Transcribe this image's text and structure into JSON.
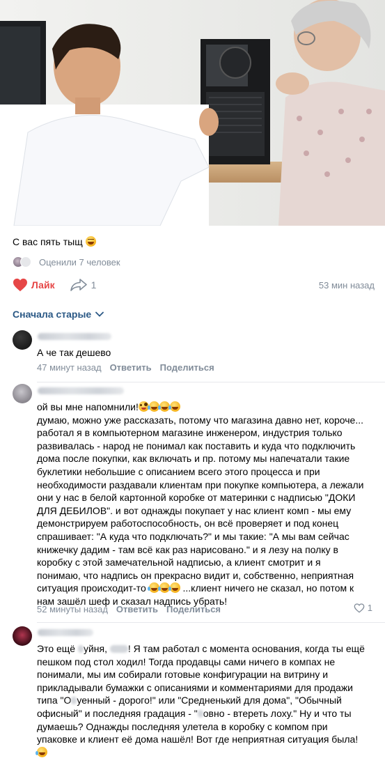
{
  "post": {
    "caption": "С вас пять тыщ",
    "caption_emoji": "grinning-emoji",
    "rated_text": "Оценили 7 человек",
    "like_label": "Лайк",
    "share_count": "1",
    "time": "53 мин назад"
  },
  "comments_sort": {
    "label": "Сначала старые"
  },
  "comments": [
    {
      "text": "А че так дешево",
      "time": "47 минут назад",
      "reply": "Ответить",
      "share": "Поделиться"
    },
    {
      "text_head": "ой вы мне напомнили!",
      "text": "думаю, можно уже рассказать, потому что магазина давно нет, короче...\nработал я в компьютерном магазине инженером, индустрия только\nразвивалась - народ не понимал как поставить и куда что подключить\nдома после покупки, как включать и пр. потому мы напечатали такие\nбуклетики небольшие с описанием всего этого процесса и при\nнеобходимости раздавали клиентам при покупке компьютера, а лежали\nони у нас в белой картонной коробке от материнки с надписью \"ДОКИ\nДЛЯ ДЕБИЛОВ\". и вот однажды покупает у нас клиент комп - мы ему\nдемонстрируем работоспособность, он всё проверяет и под конец\nспрашивает: \"А куда что подключать?\" и мы такие: \"А мы вам сейчас\nкнижечку дадим - там всё как раз нарисовано.\" и я лезу на полку в\nкоробку с этой замечательной надписью, а клиент смотрит и я\nпонимаю, что надпись он прекрасно видит и, собственно, неприятная",
      "text_tail_a": "ситуация происходит-то",
      "text_tail_b": " ...клиент ничего не сказал, но потом к\nнам зашёл шеф и сказал надпись убрать!",
      "time": "52 минуты назад",
      "reply": "Ответить",
      "share": "Поделиться",
      "likes": "1"
    },
    {
      "part1": "Это ещё ",
      "part2": "уйня, ",
      "part3": "! Я там работал с момента основания, когда ты ещё\nпешком под стол ходил! Тогда продавцы сами ничего в компах не\nпонимали, мы им собирали готовые конфигурации на витрину и\nприкладывали бумажки с описаниями и комментариями для продажи\nтипа \"О",
      "part4": "уенный - дорого!\" или \"Средненький для дома\", \"Обычный\nофисный\" и последняя градация - \"",
      "part5": "овно - втереть лоху.\" Ну и что ты\nдумаешь? Однажды последняя улетела в коробку с компом при\nупаковке и клиент её дома нашёл! Вот где неприятная ситуация была!"
    }
  ]
}
